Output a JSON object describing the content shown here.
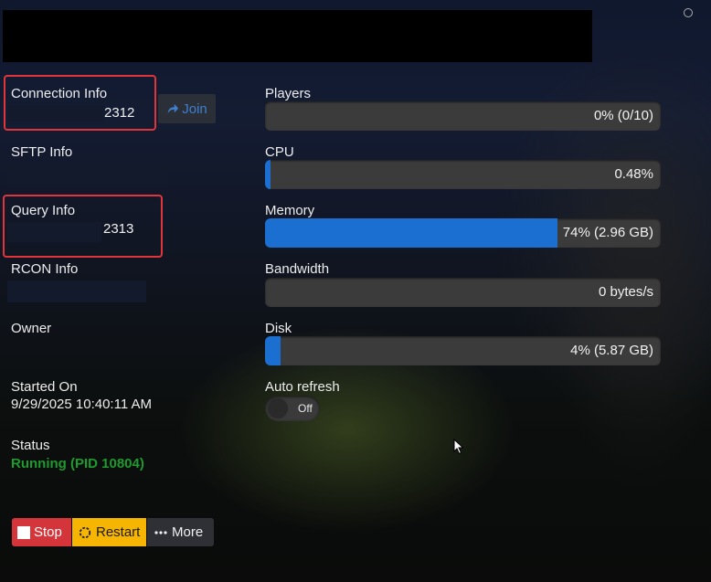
{
  "left": {
    "connection": {
      "label": "Connection Info",
      "port": "2312",
      "join_label": "Join"
    },
    "sftp": {
      "label": "SFTP Info"
    },
    "query": {
      "label": "Query Info",
      "port": "2313"
    },
    "rcon": {
      "label": "RCON Info"
    },
    "owner": {
      "label": "Owner"
    },
    "started": {
      "label": "Started On",
      "value": "9/29/2025 10:40:11 AM"
    },
    "status": {
      "label": "Status",
      "value": "Running (PID 10804)"
    }
  },
  "metrics": [
    {
      "label": "Players",
      "text": "0% (0/10)",
      "percent": 0
    },
    {
      "label": "CPU",
      "text": "0.48%",
      "percent": 0.48
    },
    {
      "label": "Memory",
      "text": "74% (2.96 GB)",
      "percent": 74
    },
    {
      "label": "Bandwidth",
      "text": "0 bytes/s",
      "percent": 0
    },
    {
      "label": "Disk",
      "text": "4% (5.87 GB)",
      "percent": 4
    }
  ],
  "auto_refresh": {
    "label": "Auto refresh",
    "state": "Off"
  },
  "actions": {
    "stop": "Stop",
    "restart": "Restart",
    "more": "More"
  },
  "colors": {
    "fill": "#1a6fd0",
    "status_ok": "#1f9a2e",
    "stop": "#d3353a",
    "restart": "#f5b500",
    "highlight": "#e0353b"
  },
  "icons": {
    "join": "share-arrow-icon",
    "stop": "stop-square-icon",
    "restart": "refresh-icon",
    "more": "ellipsis-icon"
  }
}
